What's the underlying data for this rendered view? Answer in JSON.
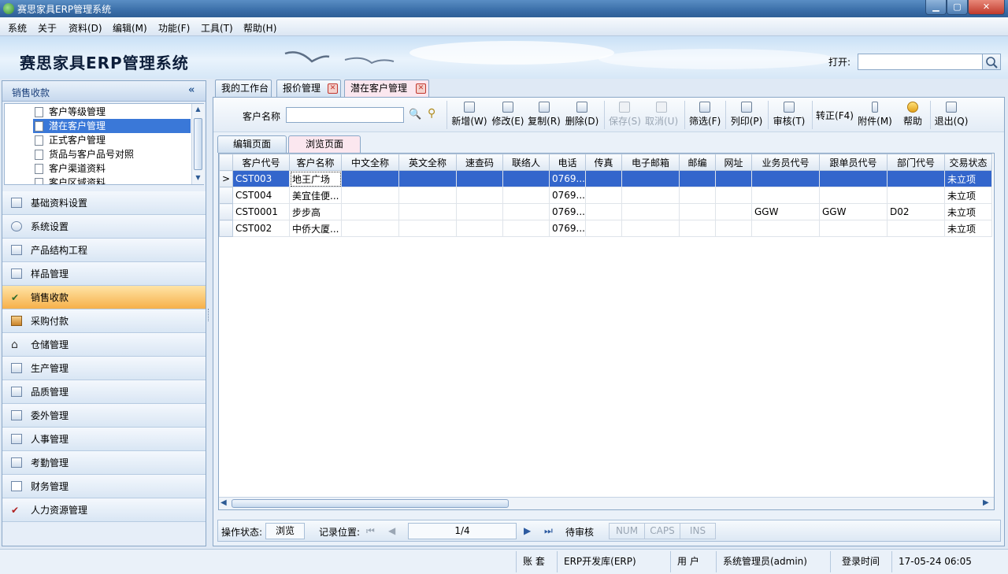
{
  "window": {
    "title": "赛思家具ERP管理系统"
  },
  "menu": [
    "系统",
    "关于",
    "资料(D)",
    "编辑(M)",
    "功能(F)",
    "工具(T)",
    "帮助(H)"
  ],
  "banner": {
    "app_title": "赛思家具ERP管理系统",
    "open_label": "打开:",
    "open_value": ""
  },
  "sidebar": {
    "header": "销售收款",
    "collapse": "«",
    "tree": [
      "客户等级管理",
      "潜在客户管理",
      "正式客户管理",
      "货品与客户品号对照",
      "客户渠道资料",
      "客户区域资料"
    ],
    "tree_selected": 1,
    "nav": [
      "基础资料设置",
      "系统设置",
      "产品结构工程",
      "样品管理",
      "销售收款",
      "采购付款",
      "仓储管理",
      "生产管理",
      "品质管理",
      "委外管理",
      "人事管理",
      "考勤管理",
      "财务管理",
      "人力资源管理"
    ],
    "nav_active": 4
  },
  "tabs": [
    {
      "label": "我的工作台",
      "closable": false
    },
    {
      "label": "报价管理",
      "closable": true
    },
    {
      "label": "潜在客户管理",
      "closable": true,
      "active": true
    }
  ],
  "toolbar": {
    "customer_label": "客户名称",
    "customer_value": "",
    "new": "新增(W)",
    "edit": "修改(E)",
    "copy": "复制(R)",
    "delete": "删除(D)",
    "save": "保存(S)",
    "cancel": "取消(U)",
    "filter": "筛选(F)",
    "print": "列印(P)",
    "review": "审核(T)",
    "convert": "转正(F4)",
    "attach": "附件(M)",
    "help": "帮助",
    "exit": "退出(Q)"
  },
  "subtabs": [
    "编辑页面",
    "浏览页面"
  ],
  "grid": {
    "columns": [
      "客户代号",
      "客户名称",
      "中文全称",
      "英文全称",
      "速查码",
      "联络人",
      "电话",
      "传真",
      "电子邮箱",
      "邮编",
      "网址",
      "业务员代号",
      "跟单员代号",
      "部门代号",
      "交易状态"
    ],
    "rows": [
      [
        "CST003",
        "地王广场",
        "",
        "",
        "",
        "",
        "0769...",
        "",
        "",
        "",
        "",
        "",
        "",
        "",
        "未立项"
      ],
      [
        "CST004",
        "美宜佳便...",
        "",
        "",
        "",
        "",
        "0769...",
        "",
        "",
        "",
        "",
        "",
        "",
        "",
        "未立项"
      ],
      [
        "CST0001",
        "步步高",
        "",
        "",
        "",
        "",
        "0769...",
        "",
        "",
        "",
        "",
        "GGW",
        "GGW",
        "D02",
        "未立项"
      ],
      [
        "CST002",
        "中侨大厦...",
        "",
        "",
        "",
        "",
        "0769...",
        "",
        "",
        "",
        "",
        "",
        "",
        "",
        "未立项"
      ]
    ],
    "selected_row": 0,
    "row_indicator": ">"
  },
  "status": {
    "op_label": "操作状态:",
    "op_value": "浏览",
    "rec_label": "记录位置:",
    "position": "1/4",
    "review_state": "待审核",
    "indicators": [
      "NUM",
      "CAPS",
      "INS"
    ]
  },
  "footer": {
    "account_label": "账 套",
    "account_value": "ERP开发库(ERP)",
    "user_label": "用 户",
    "user_value": "系统管理员(admin)",
    "login_label": "登录时间",
    "login_value": "17-05-24 06:05"
  }
}
